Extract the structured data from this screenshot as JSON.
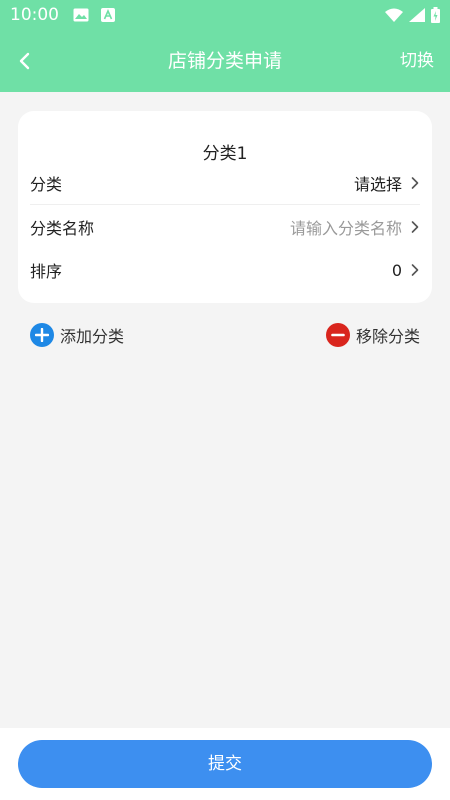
{
  "status_bar": {
    "time": "10:00",
    "icons": [
      "image-icon",
      "font-a-icon",
      "wifi-icon",
      "signal-icon",
      "battery-icon"
    ]
  },
  "nav": {
    "back_icon": "chevron-left-icon",
    "title": "店铺分类申请",
    "right_action": "切换"
  },
  "card": {
    "title": "分类1",
    "rows": [
      {
        "label": "分类",
        "value": "请选择"
      },
      {
        "label": "分类名称",
        "placeholder": "请输入分类名称"
      },
      {
        "label": "排序",
        "value": "0"
      }
    ]
  },
  "actions": {
    "add_label": "添加分类",
    "remove_label": "移除分类"
  },
  "submit": {
    "label": "提交"
  },
  "colors": {
    "header": "#6fe0a6",
    "add": "#1e88e5",
    "remove": "#d9251d",
    "submit": "#3d8ff0"
  }
}
